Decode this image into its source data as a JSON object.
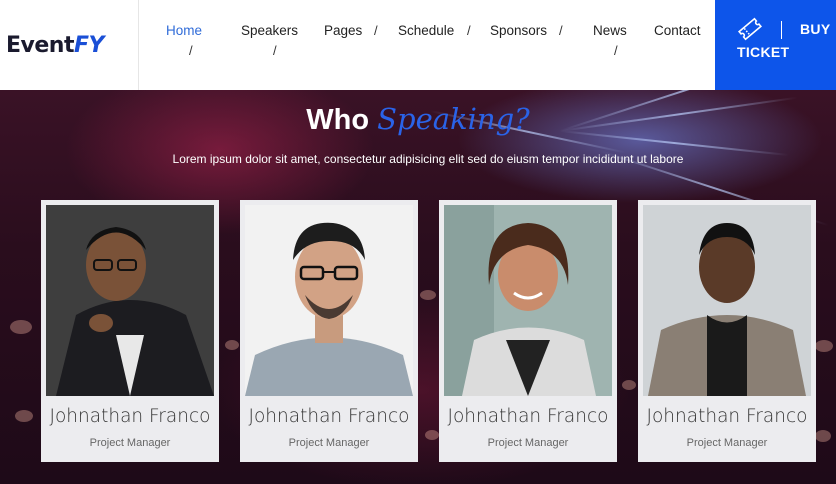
{
  "brand": {
    "part1": "Event",
    "part2": "FY"
  },
  "nav": {
    "items": [
      {
        "label": "Home",
        "active": true
      },
      {
        "label": "Speakers"
      },
      {
        "label": "Pages"
      },
      {
        "label": "Schedule"
      },
      {
        "label": "Sponsors"
      },
      {
        "label": "News"
      },
      {
        "label": "Contact"
      }
    ],
    "separator": "/"
  },
  "ticket": {
    "icon": "ticket-icon",
    "buy_label": "BUY",
    "ticket_label": "TICKET"
  },
  "section": {
    "title_main": "Who",
    "title_accent": "Speaking?",
    "subtitle": "Lorem ipsum dolor sit amet, consectetur adipisicing elit sed do eiusm tempor incididunt ut labore"
  },
  "speakers": [
    {
      "name": "Johnathan Franco",
      "role": "Project Manager"
    },
    {
      "name": "Johnathan Franco",
      "role": "Project Manager"
    },
    {
      "name": "Johnathan Franco",
      "role": "Project Manager"
    },
    {
      "name": "Johnathan Franco",
      "role": "Project Manager"
    }
  ],
  "colors": {
    "accent": "#0d55ea",
    "nav_active": "#2f6bd8",
    "card_bg": "#ececef"
  }
}
